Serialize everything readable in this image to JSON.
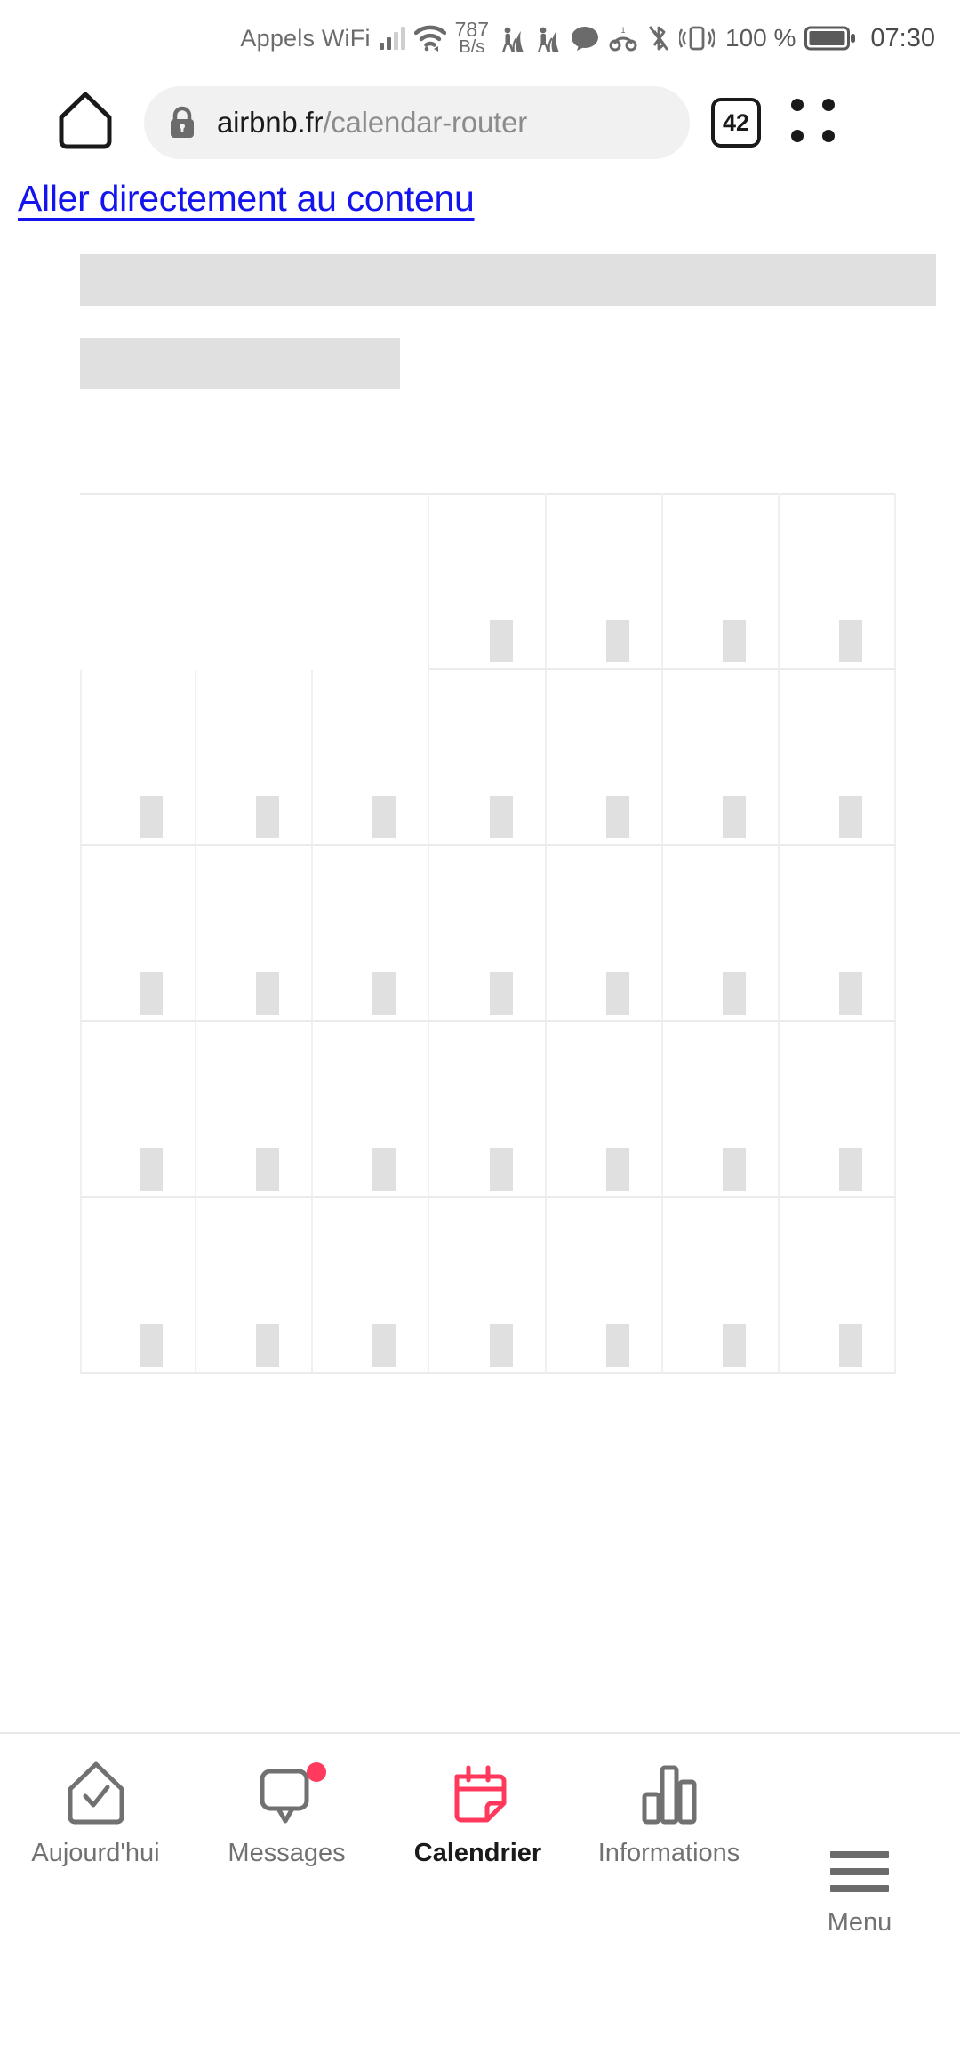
{
  "status_bar": {
    "carrier_label": "Appels WiFi",
    "data_rate_value": "787",
    "data_rate_unit": "B/s",
    "battery_percent": "100 %",
    "clock": "07:30",
    "icons": [
      "signal-bars-icon",
      "wifi-icon",
      "data-transfer-icon",
      "alarm-icon",
      "alarm-icon",
      "speech-bubble-icon",
      "headphones-icon",
      "bluetooth-off-icon",
      "vibrate-icon",
      "battery-full-icon"
    ]
  },
  "browser": {
    "home_icon": "home-icon",
    "lock_icon": "lock-icon",
    "url_host": "airbnb.fr",
    "url_path": "/calendar-router",
    "tab_count": "42",
    "menu_icon": "four-dots-menu-icon"
  },
  "page": {
    "skip_link": "Aller directement au contenu",
    "loading_placeholders": [
      {
        "name": "title-skeleton"
      },
      {
        "name": "subtitle-skeleton"
      }
    ]
  },
  "calendar": {
    "columns": 7,
    "rows": 5,
    "leading_blank_cells": 3,
    "cell_skeleton_name": "day-number-skeleton"
  },
  "bottom_nav": {
    "items": [
      {
        "label": "Aujourd'hui",
        "icon": "house-check-icon",
        "active": false,
        "badge": false
      },
      {
        "label": "Messages",
        "icon": "speech-bubble-icon",
        "active": false,
        "badge": true
      },
      {
        "label": "Calendrier",
        "icon": "calendar-icon",
        "active": true,
        "badge": false
      },
      {
        "label": "Informations",
        "icon": "bar-chart-icon",
        "active": false,
        "badge": false
      }
    ],
    "menu": {
      "label": "Menu",
      "icon": "hamburger-icon"
    }
  },
  "colors": {
    "accent": "#FF385C",
    "badge": "#FF3A5E",
    "link": "#1414EE",
    "skeleton": "#E0E0E0",
    "grid_line": "#EBEBEB",
    "nav_inactive": "#717171",
    "nav_active": "#1A1A1A"
  }
}
